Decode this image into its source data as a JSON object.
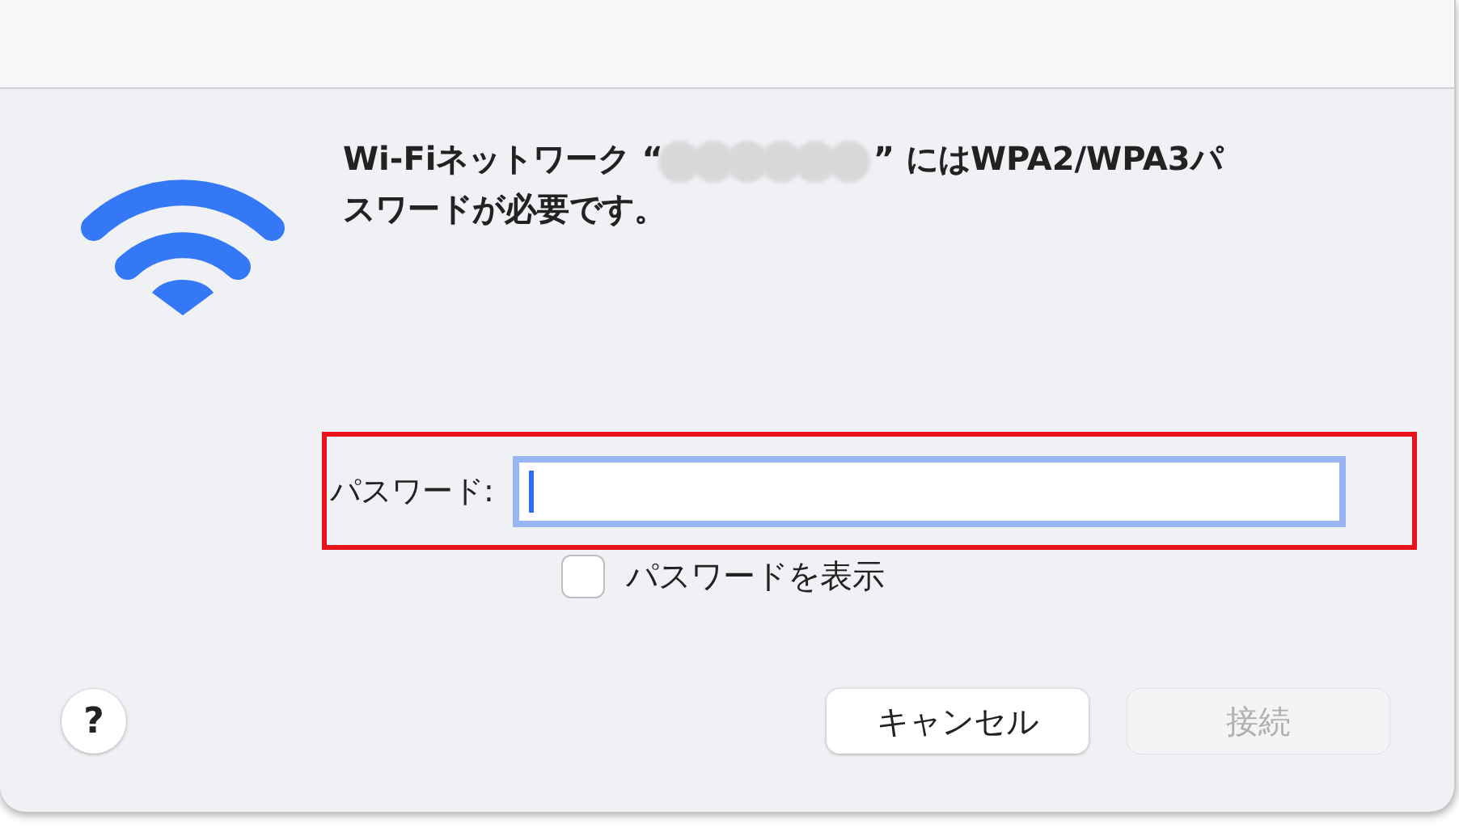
{
  "message": {
    "before": "Wi-Fiネットワーク “",
    "after": "” にはWPA2/WPA3パスワードが必要です。"
  },
  "password": {
    "label": "パスワード:",
    "focused": true,
    "highlighted": true
  },
  "show_password": {
    "label": "パスワードを表示",
    "checked": false
  },
  "buttons": [
    {
      "label": "?",
      "kind": "help",
      "disabled": false
    },
    {
      "label": "キャンセル",
      "kind": "cancel",
      "disabled": false
    },
    {
      "label": "接続",
      "kind": "default",
      "disabled": true
    }
  ]
}
